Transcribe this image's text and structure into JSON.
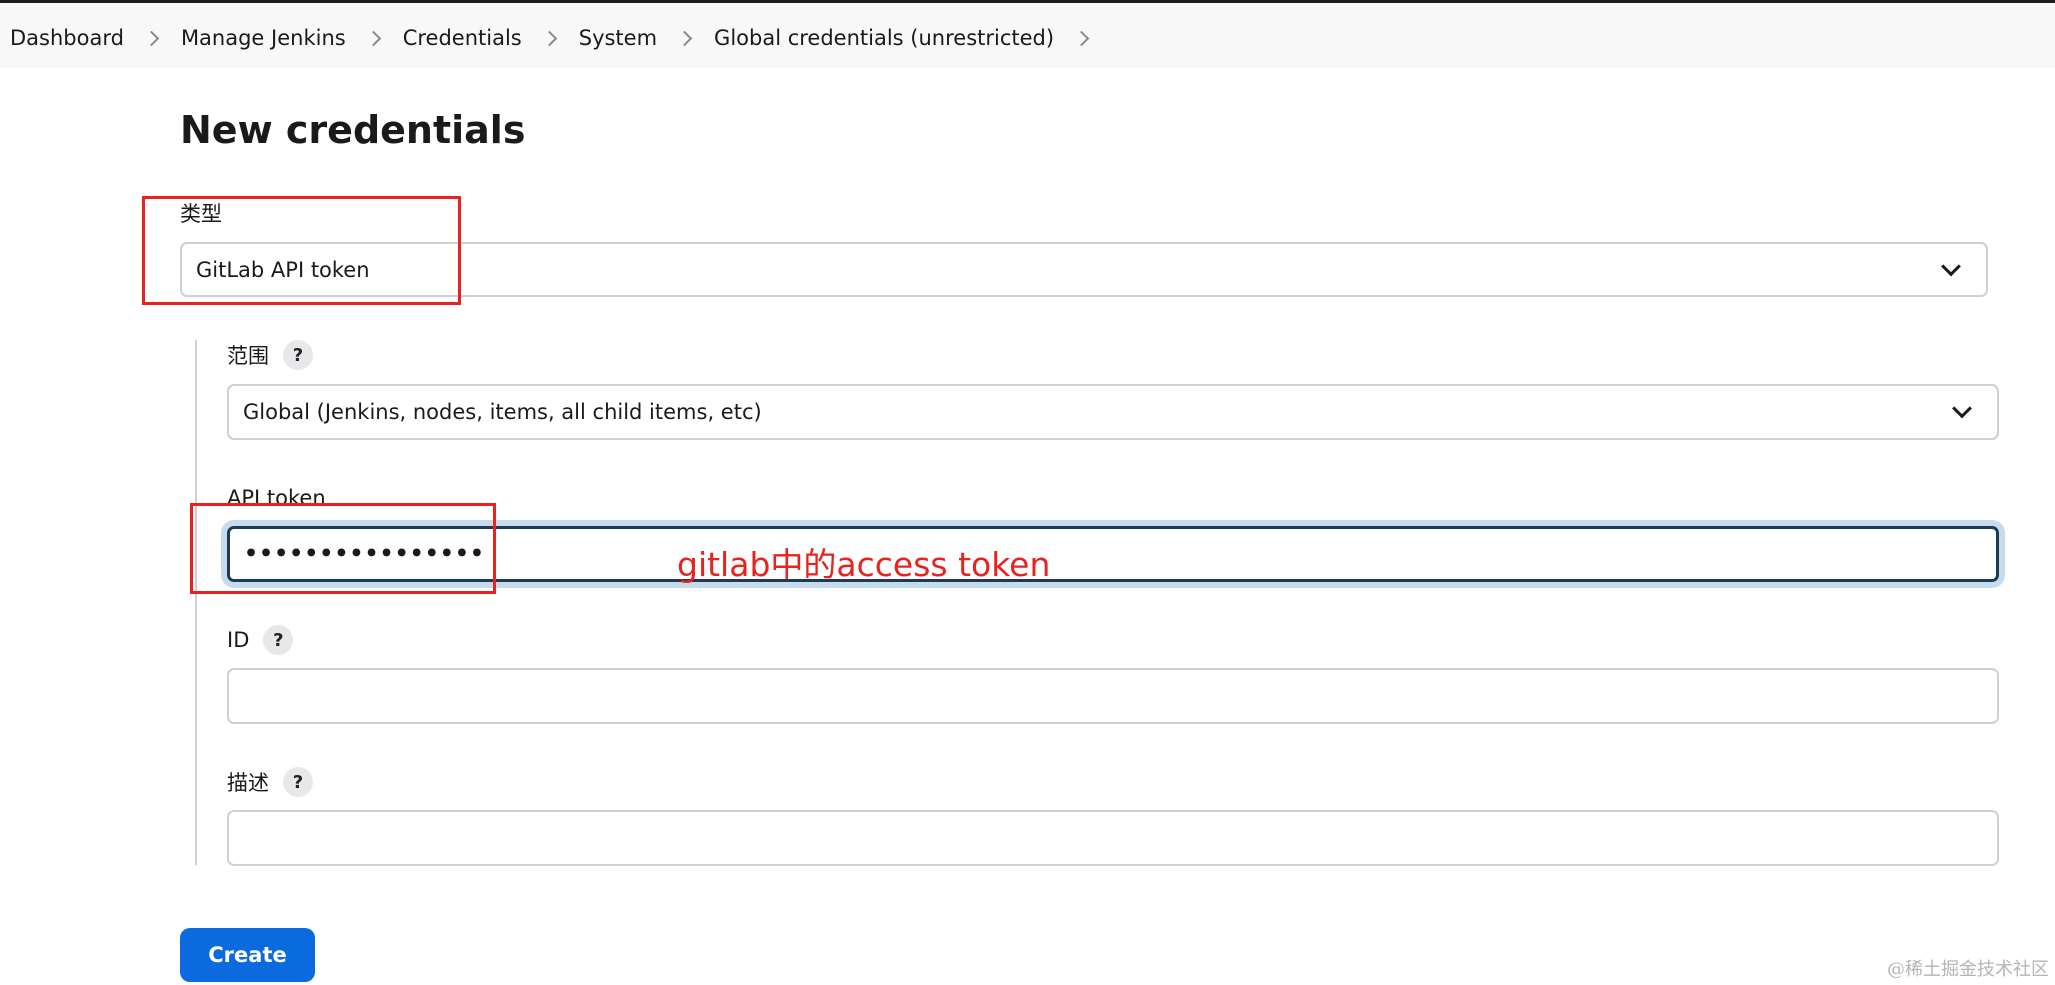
{
  "breadcrumb": {
    "items": [
      "Dashboard",
      "Manage Jenkins",
      "Credentials",
      "System",
      "Global credentials (unrestricted)"
    ]
  },
  "page": {
    "title": "New credentials"
  },
  "form": {
    "kind": {
      "label": "类型",
      "value": "GitLab API token"
    },
    "scope": {
      "label": "范围",
      "help": "?",
      "value": "Global (Jenkins, nodes, items, all child items, etc)"
    },
    "api_token": {
      "label": "API token",
      "value": "••••••••••••••••"
    },
    "id": {
      "label": "ID",
      "help": "?",
      "value": ""
    },
    "description": {
      "label": "描述",
      "help": "?",
      "value": ""
    },
    "create_label": "Create"
  },
  "annotation": {
    "text": "gitlab中的access token",
    "color": "#e8231f"
  },
  "watermark": "@稀土掘金技术社区",
  "colors": {
    "primary_button": "#0b6bde",
    "focus_ring": "#c6dced"
  }
}
